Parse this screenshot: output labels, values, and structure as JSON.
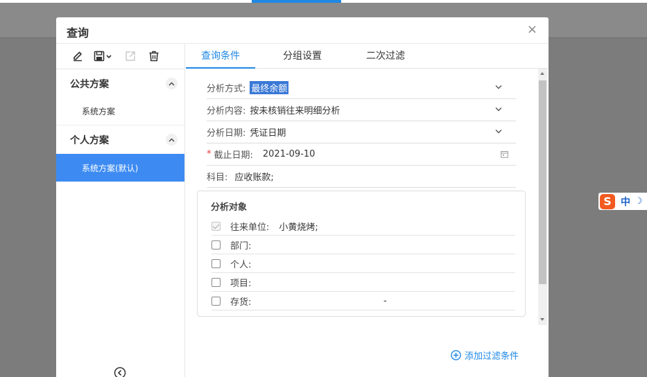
{
  "dialog": {
    "title": "查询",
    "close_glyph": "×"
  },
  "toolbar": {
    "icons": [
      "edit-icon",
      "save-icon",
      "dropdown-arrow-icon",
      "export-icon",
      "delete-icon"
    ]
  },
  "sidebar": {
    "groups": [
      {
        "label": "公共方案",
        "items": [
          {
            "label": "系统方案",
            "active": false
          }
        ]
      },
      {
        "label": "个人方案",
        "items": [
          {
            "label": "系统方案(默认)",
            "active": true
          }
        ]
      }
    ]
  },
  "tabs": [
    {
      "label": "查询条件",
      "active": true
    },
    {
      "label": "分组设置",
      "active": false
    },
    {
      "label": "二次过滤",
      "active": false
    }
  ],
  "form": {
    "analysis_mode": {
      "label": "分析方式:",
      "value": "最终余额"
    },
    "analysis_content": {
      "label": "分析内容:",
      "value": "按未核销往来明细分析"
    },
    "analysis_date": {
      "label": "分析日期:",
      "value": "凭证日期"
    },
    "cutoff_date": {
      "required_mark": "*",
      "label": "截止日期:",
      "value": "2021-09-10"
    },
    "subject": {
      "label": "科目:",
      "value": "应收账款;"
    }
  },
  "analysis_object": {
    "title": "分析对象",
    "rows": [
      {
        "label": "往来单位:",
        "value": "小黄烧烤;",
        "checked": true
      },
      {
        "label": "部门:",
        "value": "",
        "checked": false
      },
      {
        "label": "个人:",
        "value": "",
        "checked": false
      },
      {
        "label": "项目:",
        "value": "",
        "checked": false
      },
      {
        "label": "存货:",
        "value": "",
        "checked": false,
        "dash": "-"
      }
    ]
  },
  "add_filter": {
    "label": "添加过滤条件"
  },
  "ime": {
    "logo": "S",
    "mode": "中",
    "moon": "☽"
  },
  "colors": {
    "accent": "#1e88e5",
    "active_item": "#3d8bf2",
    "ime_logo": "#f25a1f"
  }
}
